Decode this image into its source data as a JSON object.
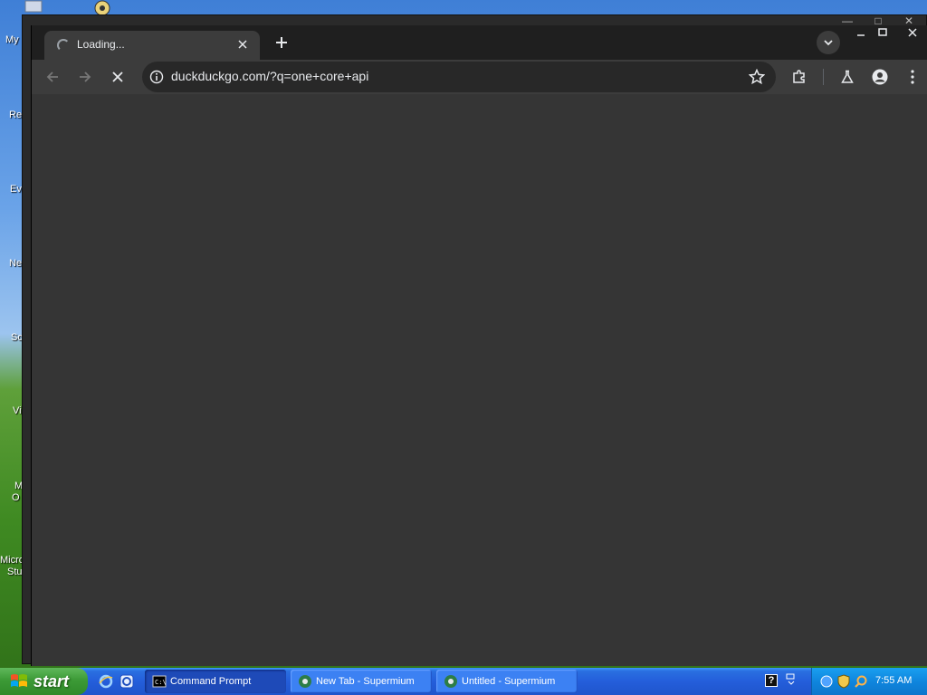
{
  "desktop": {
    "labels": [
      "My",
      "Re",
      "Ev",
      "Ne",
      "Sc",
      "Vi",
      "M",
      "O",
      "Micro",
      "Stu"
    ]
  },
  "browser": {
    "tab_title": "Loading...",
    "url": "duckduckgo.com/?q=one+core+api"
  },
  "taskbar": {
    "start_label": "start",
    "tasks": [
      {
        "label": "Command Prompt"
      },
      {
        "label": "New Tab - Supermium"
      },
      {
        "label": "Untitled - Supermium"
      }
    ],
    "clock": "7:55 AM",
    "help_label": "?"
  },
  "colors": {
    "browser_bg": "#1f1f1f",
    "toolbar_bg": "#3c3c3c",
    "content_bg": "#353535",
    "taskbar_blue": "#245edb",
    "start_green": "#3c9a36"
  }
}
